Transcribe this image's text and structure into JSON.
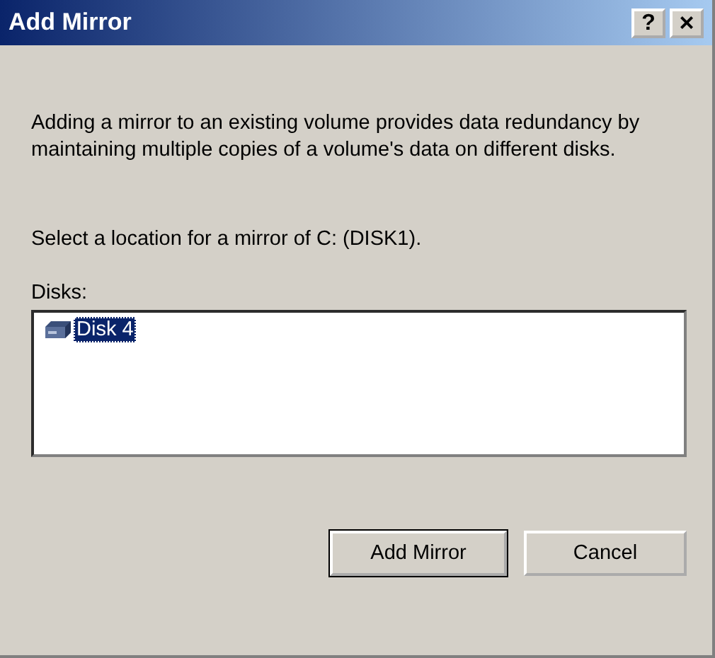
{
  "window": {
    "title": "Add Mirror",
    "title_buttons": [
      {
        "kind": "help",
        "label": "?"
      },
      {
        "kind": "close",
        "label": "×"
      }
    ]
  },
  "description": "Adding a mirror to an existing volume provides data redundancy by maintaining multiple copies of a volume's data on different disks.",
  "prompt": "Select a location for a mirror of C: (DISK1).",
  "disks": {
    "label": "Disks:",
    "items": [
      {
        "name": "Disk 4",
        "selected": true
      }
    ]
  },
  "buttons": [
    {
      "label": "Add Mirror",
      "default": true
    },
    {
      "label": "Cancel",
      "default": false
    }
  ]
}
